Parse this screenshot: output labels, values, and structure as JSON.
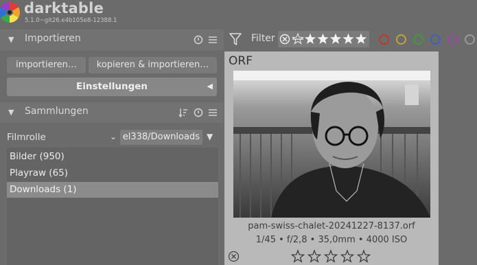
{
  "app": {
    "title": "darktable",
    "version": "5.1.0~git26.e4b105e8-12388.1"
  },
  "import_module": {
    "title": "Importieren",
    "import_button": "importieren…",
    "copy_import_button": "kopieren & importieren…",
    "settings_button": "Einstellungen"
  },
  "collections_module": {
    "title": "Sammlungen",
    "property": "Filmrolle",
    "value": "el338/Downloads",
    "items": [
      {
        "label": "Bilder (950)",
        "selected": false
      },
      {
        "label": "Playraw (65)",
        "selected": false
      },
      {
        "label": "Downloads (1)",
        "selected": true
      }
    ]
  },
  "filter_bar": {
    "label": "Filter",
    "star_rating_count": 5,
    "color_labels": [
      "#c0392b",
      "#c8a233",
      "#3d9b3d",
      "#3e5fc4",
      "#a340b0",
      "#9a9a9a"
    ]
  },
  "thumbnail": {
    "extension": "ORF",
    "filename": "pam-swiss-chalet-20241227-8137.orf",
    "exif": "1/45 • f/2,8 • 35,0mm • 4000 ISO",
    "rating": 0
  },
  "icons": {
    "section_collapse": "triangle-down-icon",
    "reset": "reset-icon",
    "presets": "hamburger-menu-icon",
    "sort": "sort-icon",
    "filter": "filter-funnel-icon",
    "reject": "reject-x-icon",
    "star": "star-icon"
  }
}
